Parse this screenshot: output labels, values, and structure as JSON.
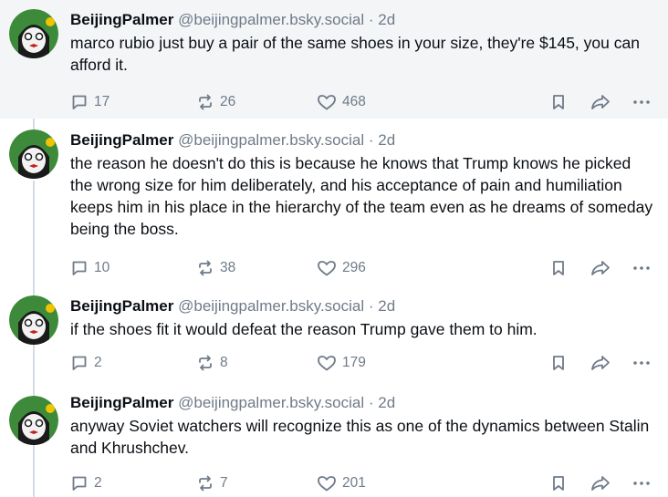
{
  "posts": [
    {
      "author": "BeijingPalmer",
      "handle": "@beijingpalmer.bsky.social",
      "separator": "·",
      "time": "2d",
      "text": "marco rubio just buy a pair of the same shoes in your size, they're $145, you can afford it.",
      "replies": "17",
      "reposts": "26",
      "likes": "468"
    },
    {
      "author": "BeijingPalmer",
      "handle": "@beijingpalmer.bsky.social",
      "separator": "·",
      "time": "2d",
      "text": "the reason he doesn't do this is because he knows that Trump knows he picked the wrong size for him deliberately, and his acceptance of pain and humiliation keeps him in his place in the hierarchy of the team even as he dreams of someday being the boss.",
      "replies": "10",
      "reposts": "38",
      "likes": "296"
    },
    {
      "author": "BeijingPalmer",
      "handle": "@beijingpalmer.bsky.social",
      "separator": "·",
      "time": "2d",
      "text": "if the shoes fit it would defeat the reason Trump gave them to him.",
      "replies": "2",
      "reposts": "8",
      "likes": "179"
    },
    {
      "author": "BeijingPalmer",
      "handle": "@beijingpalmer.bsky.social",
      "separator": "·",
      "time": "2d",
      "text": "anyway Soviet watchers will recognize this as one of the dynamics between Stalin and Khrushchev.",
      "replies": "2",
      "reposts": "7",
      "likes": "201"
    }
  ],
  "icons": {
    "reply": "speech-bubble-icon",
    "repost": "repost-arrows-icon",
    "like": "heart-icon",
    "bookmark": "bookmark-icon",
    "share": "share-arrow-icon",
    "more": "ellipsis-icon"
  },
  "colors": {
    "muted": "#6f7b89",
    "highlight_bg": "#f3f5f7",
    "thread_line": "#d4dbe2"
  }
}
